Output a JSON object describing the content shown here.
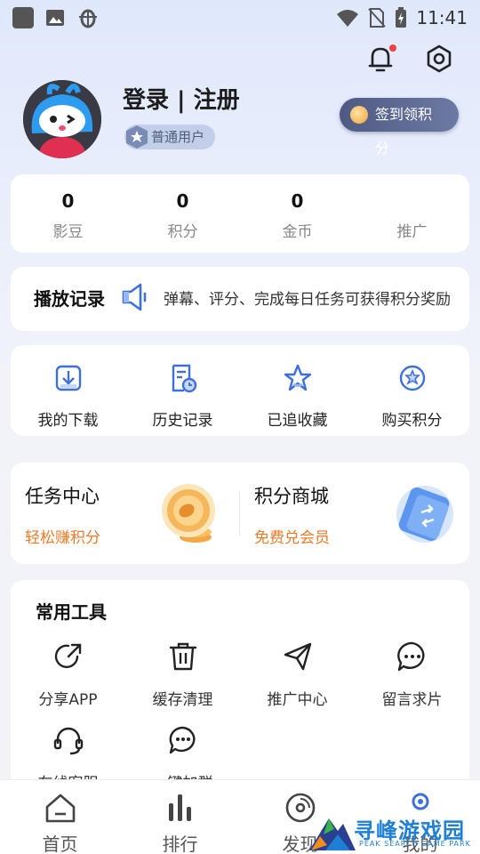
{
  "status_bar": {
    "time": "11:41"
  },
  "profile": {
    "title": "登录 | 注册",
    "badge": "普通用户",
    "signin_button": "签到领积分"
  },
  "stats": [
    {
      "value": "0",
      "label": "影豆"
    },
    {
      "value": "0",
      "label": "积分"
    },
    {
      "value": "0",
      "label": "金币"
    },
    {
      "value": "",
      "label": "推广"
    }
  ],
  "history": {
    "title": "播放记录",
    "marquee": "弹幕、评分、完成每日任务可获得积分奖励"
  },
  "quick_actions": [
    {
      "label": "我的下载",
      "icon": "download-icon"
    },
    {
      "label": "历史记录",
      "icon": "history-icon"
    },
    {
      "label": "已追收藏",
      "icon": "star-icon"
    },
    {
      "label": "购买积分",
      "icon": "buy-points-icon"
    }
  ],
  "promo": {
    "task": {
      "title": "任务中心",
      "subtitle": "轻松赚积分"
    },
    "mall": {
      "title": "积分商城",
      "subtitle": "免费兑会员"
    }
  },
  "tools": {
    "title": "常用工具",
    "items": [
      {
        "label": "分享APP",
        "icon": "share-icon"
      },
      {
        "label": "缓存清理",
        "icon": "trash-icon"
      },
      {
        "label": "推广中心",
        "icon": "send-icon"
      },
      {
        "label": "留言求片",
        "icon": "message-icon"
      },
      {
        "label": "在线客服",
        "icon": "headset-icon"
      },
      {
        "label": "一键加群",
        "icon": "chat-icon"
      }
    ]
  },
  "tabbar": [
    {
      "label": "首页",
      "icon": "home-icon"
    },
    {
      "label": "排行",
      "icon": "rank-icon"
    },
    {
      "label": "发现",
      "icon": "discover-icon"
    },
    {
      "label": "我的",
      "icon": "profile-icon"
    }
  ],
  "watermark": {
    "text": "寻峰游戏园",
    "sub": "PEAK SEARCH GAME PARK"
  },
  "colors": {
    "accent": "#3e6fe0",
    "orange": "#f07a2a",
    "badge_bg": "#c3cfe9"
  }
}
